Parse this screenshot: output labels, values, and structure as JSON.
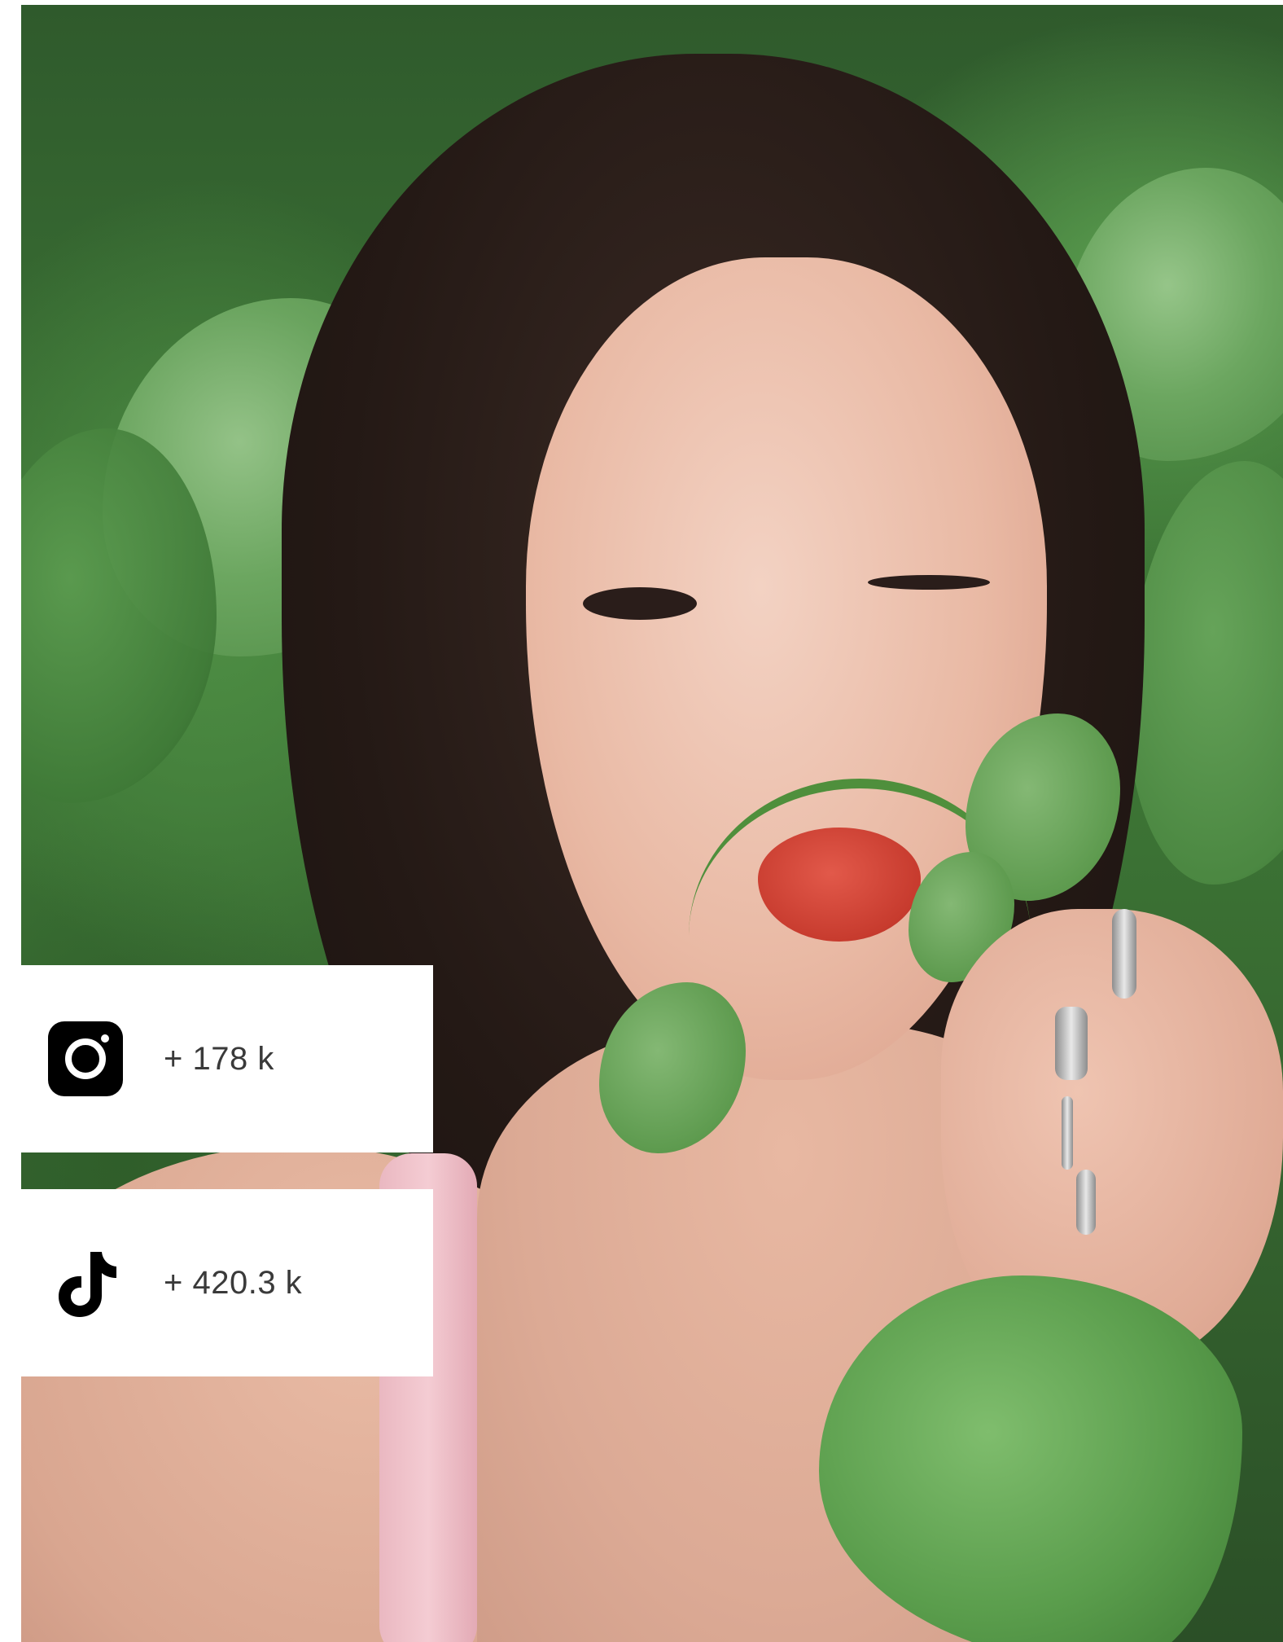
{
  "photo": {
    "subject": "portrait"
  },
  "stats": [
    {
      "platform_icon": "instagram-icon",
      "value": "+ 178 k"
    },
    {
      "platform_icon": "tiktok-icon",
      "value": "+ 420.3 k"
    }
  ],
  "colors": {
    "card_background": "#ffffff",
    "icon_color": "#000000",
    "text_color": "#3a3a3a"
  }
}
